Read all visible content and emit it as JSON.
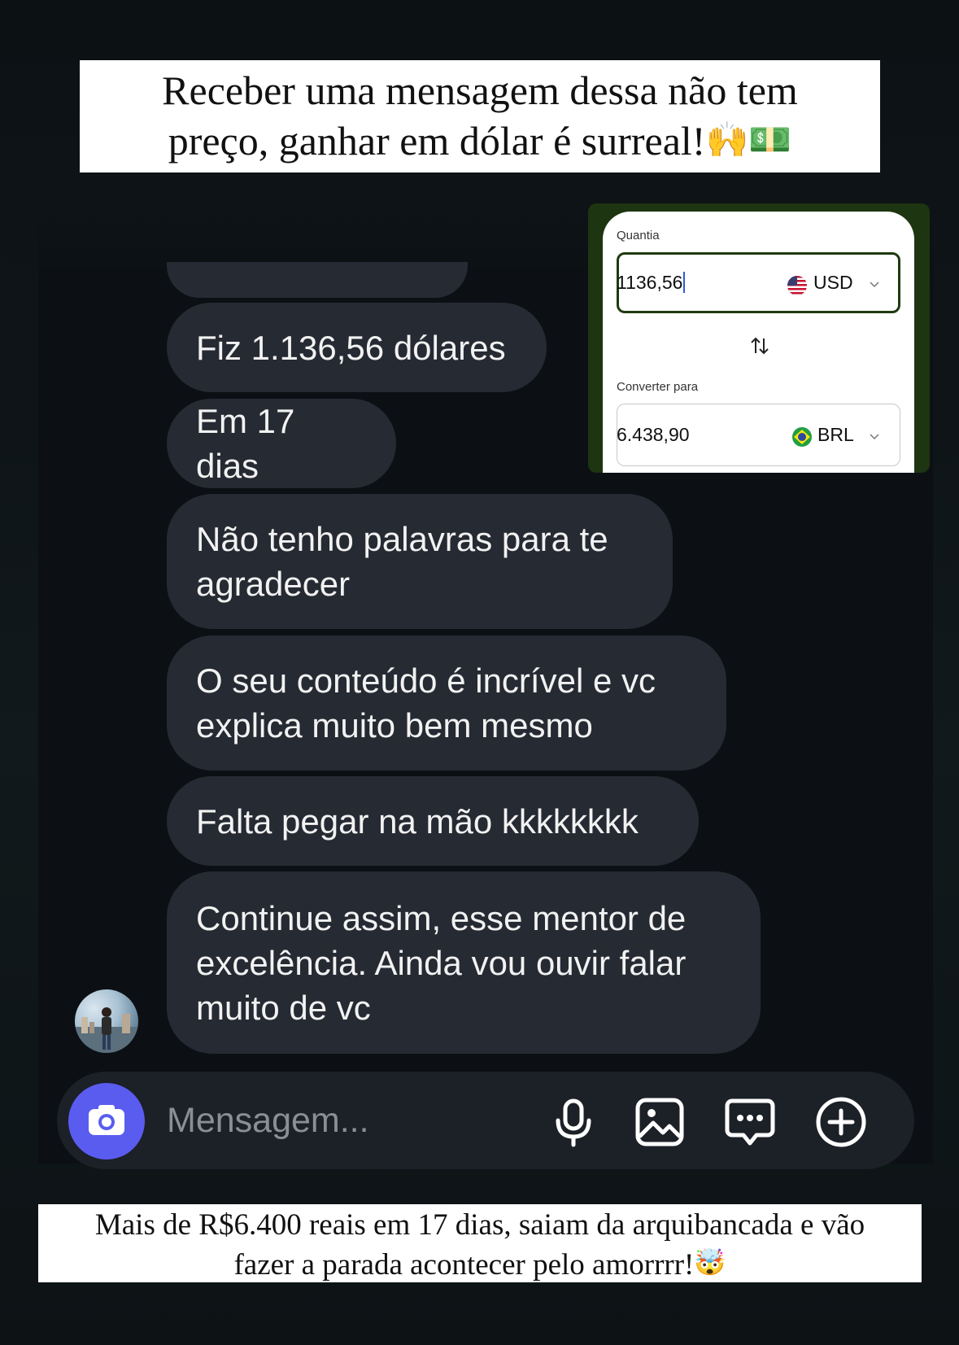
{
  "captions": {
    "top_line1": "Receber uma mensagem dessa não tem",
    "top_line2": "preço, ganhar em dólar é surreal!",
    "top_emoji": "🙌💵",
    "bottom_line1": "Mais de R$6.400 reais em 17 dias, saiam da arquibancada e vão",
    "bottom_line2": "fazer a parada acontecer pelo amorrrr!",
    "bottom_emoji": "🤯"
  },
  "converter": {
    "amount_label": "Quantia",
    "amount_value": "1136,56",
    "from_currency": "USD",
    "swap_icon": "swap-vertical-icon",
    "convert_to_label": "Converter para",
    "converted_value": "6.438,90",
    "to_currency": "BRL"
  },
  "messages": [
    {
      "text": "Fiz 1.136,56 dólares"
    },
    {
      "text": "Em 17 dias"
    },
    {
      "text": "Não tenho palavras para te agradecer"
    },
    {
      "text": "O seu conteúdo é incrível e vc explica muito bem mesmo"
    },
    {
      "text": "Falta pegar na mão kkkkkkkk"
    },
    {
      "text": "Continue assim, esse mentor de excelência. Ainda vou ouvir falar muito de vc"
    }
  ],
  "composer": {
    "placeholder": "Mensagem...",
    "icons": [
      "camera-icon",
      "microphone-icon",
      "gallery-icon",
      "sticker-chat-icon",
      "plus-icon"
    ],
    "camera_color": "#5a5cf0"
  },
  "colors": {
    "background": "#0c1014",
    "bubble": "#262a33",
    "converter_frame": "#1d3511",
    "converter_border_active": "#1f3a10"
  }
}
